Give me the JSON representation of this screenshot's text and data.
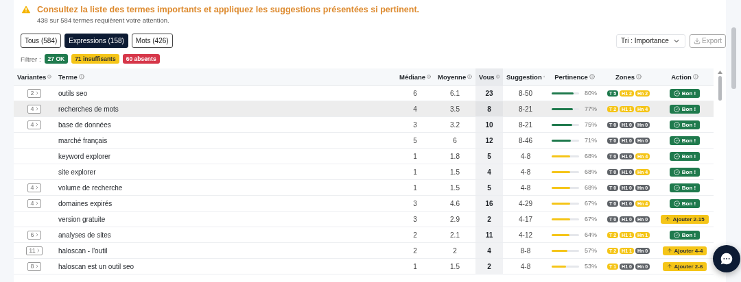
{
  "alert": {
    "title": "Consultez la liste des termes importants et appliquez les suggestions présentées si pertinent.",
    "subtitle": "438 sur 584 termes requièrent votre attention."
  },
  "tabs": [
    {
      "label": "Tous (584)",
      "selected": false
    },
    {
      "label": "Expressions (158)",
      "selected": true
    },
    {
      "label": "Mots (426)",
      "selected": false
    }
  ],
  "sort": {
    "value": "Tri : Importance"
  },
  "export": {
    "label": "Export",
    "disabled": true
  },
  "filter": {
    "label": "Filtrer :",
    "chips": [
      {
        "label": "27 OK",
        "color": "#1f7a4d"
      },
      {
        "label": "71 insuffisants",
        "color": "#f5c518"
      },
      {
        "label": "60 absents",
        "color": "#d63649"
      }
    ]
  },
  "table": {
    "columns": [
      "Variantes",
      "Terme",
      "Médiane",
      "Moyenne",
      "Vous",
      "Suggestion",
      "Pertinence",
      "Zones",
      "Action"
    ],
    "rows": [
      {
        "variants": "2",
        "term": "outils seo",
        "median": "6",
        "mean": "6.1",
        "you": "23",
        "suggestion": "8-50",
        "pertinence": {
          "level": 0.8,
          "reading": "80%",
          "color": "#1f7a4d"
        },
        "zones": [
          {
            "label": "T 5",
            "color": "#1f7a4d"
          },
          {
            "label": "H1 2",
            "color": "#f5c518"
          },
          {
            "label": "Hn 2",
            "color": "#f5c518"
          }
        ],
        "action": {
          "kind": "good",
          "label": "Bon !"
        },
        "highlighted": false
      },
      {
        "variants": "4",
        "term": "recherches de mots",
        "median": "4",
        "mean": "3.5",
        "you": "8",
        "suggestion": "8-21",
        "pertinence": {
          "level": 0.77,
          "reading": "77%",
          "color": "#1f7a4d"
        },
        "zones": [
          {
            "label": "T 2",
            "color": "#f5c518"
          },
          {
            "label": "H1 1",
            "color": "#f5c518"
          },
          {
            "label": "Hn 4",
            "color": "#f5c518"
          }
        ],
        "action": {
          "kind": "good",
          "label": "Bon !"
        },
        "highlighted": true
      },
      {
        "variants": "4",
        "term": "base de données",
        "median": "3",
        "mean": "3.2",
        "you": "10",
        "suggestion": "8-21",
        "pertinence": {
          "level": 0.75,
          "reading": "75%",
          "color": "#1f7a4d"
        },
        "zones": [
          {
            "label": "T 0",
            "color": "#5f6368"
          },
          {
            "label": "H1 0",
            "color": "#5f6368"
          },
          {
            "label": "Hn 0",
            "color": "#5f6368"
          }
        ],
        "action": {
          "kind": "good",
          "label": "Bon !"
        },
        "highlighted": false
      },
      {
        "term": "marché français",
        "median": "5",
        "mean": "6",
        "you": "12",
        "suggestion": "8-46",
        "pertinence": {
          "level": 0.71,
          "reading": "71%",
          "color": "#1f7a4d"
        },
        "zones": [
          {
            "label": "T 0",
            "color": "#5f6368"
          },
          {
            "label": "H1 0",
            "color": "#5f6368"
          },
          {
            "label": "Hn 0",
            "color": "#5f6368"
          }
        ],
        "action": {
          "kind": "good",
          "label": "Bon !"
        },
        "highlighted": false
      },
      {
        "term": "keyword explorer",
        "median": "1",
        "mean": "1.8",
        "you": "5",
        "suggestion": "4-8",
        "pertinence": {
          "level": 0.68,
          "reading": "68%",
          "color": "#f5c518"
        },
        "zones": [
          {
            "label": "T 0",
            "color": "#5f6368"
          },
          {
            "label": "H1 0",
            "color": "#5f6368"
          },
          {
            "label": "Hn 4",
            "color": "#f5c518"
          }
        ],
        "action": {
          "kind": "good",
          "label": "Bon !"
        },
        "highlighted": false
      },
      {
        "term": "site explorer",
        "median": "1",
        "mean": "1.5",
        "you": "4",
        "suggestion": "4-8",
        "pertinence": {
          "level": 0.68,
          "reading": "68%",
          "color": "#f5c518"
        },
        "zones": [
          {
            "label": "T 0",
            "color": "#5f6368"
          },
          {
            "label": "H1 0",
            "color": "#5f6368"
          },
          {
            "label": "Hn 4",
            "color": "#f5c518"
          }
        ],
        "action": {
          "kind": "good",
          "label": "Bon !"
        },
        "highlighted": false
      },
      {
        "variants": "4",
        "term": "volume de recherche",
        "median": "1",
        "mean": "1.5",
        "you": "5",
        "suggestion": "4-8",
        "pertinence": {
          "level": 0.68,
          "reading": "68%",
          "color": "#f5c518"
        },
        "zones": [
          {
            "label": "T 0",
            "color": "#5f6368"
          },
          {
            "label": "H1 0",
            "color": "#5f6368"
          },
          {
            "label": "Hn 0",
            "color": "#5f6368"
          }
        ],
        "action": {
          "kind": "good",
          "label": "Bon !"
        },
        "highlighted": false
      },
      {
        "variants": "4",
        "term": "domaines expirés",
        "median": "3",
        "mean": "4.6",
        "you": "16",
        "suggestion": "4-29",
        "pertinence": {
          "level": 0.67,
          "reading": "67%",
          "color": "#f5c518"
        },
        "zones": [
          {
            "label": "T 0",
            "color": "#5f6368"
          },
          {
            "label": "H1 0",
            "color": "#5f6368"
          },
          {
            "label": "Hn 4",
            "color": "#f5c518"
          }
        ],
        "action": {
          "kind": "good",
          "label": "Bon !"
        },
        "highlighted": false
      },
      {
        "term": "version gratuite",
        "median": "3",
        "mean": "2.9",
        "you": "2",
        "suggestion": "4-17",
        "pertinence": {
          "level": 0.67,
          "reading": "67%",
          "color": "#f5c518"
        },
        "zones": [
          {
            "label": "T 0",
            "color": "#5f6368"
          },
          {
            "label": "H1 0",
            "color": "#5f6368"
          },
          {
            "label": "Hn 0",
            "color": "#5f6368"
          }
        ],
        "action": {
          "kind": "add",
          "label": "Ajouter 2-15"
        },
        "highlighted": false
      },
      {
        "variants": "6",
        "term": "analyses de sites",
        "median": "2",
        "mean": "2.1",
        "you": "11",
        "suggestion": "4-12",
        "pertinence": {
          "level": 0.64,
          "reading": "64%",
          "color": "#f5c518"
        },
        "zones": [
          {
            "label": "T 2",
            "color": "#f5c518"
          },
          {
            "label": "H1 1",
            "color": "#f5c518"
          },
          {
            "label": "Hn 1",
            "color": "#f5c518"
          }
        ],
        "action": {
          "kind": "good",
          "label": "Bon !"
        },
        "highlighted": false
      },
      {
        "variants": "11",
        "term": "haloscan - l'outil",
        "median": "2",
        "mean": "2",
        "you": "4",
        "suggestion": "8-8",
        "pertinence": {
          "level": 0.57,
          "reading": "57%",
          "color": "#f5c518"
        },
        "zones": [
          {
            "label": "T 2",
            "color": "#f5c518"
          },
          {
            "label": "H1 1",
            "color": "#f5c518"
          },
          {
            "label": "Hn 0",
            "color": "#5f6368"
          }
        ],
        "action": {
          "kind": "add",
          "label": "Ajouter 4-4"
        },
        "highlighted": false
      },
      {
        "variants": "8",
        "term": "haloscan est un outil seo",
        "median": "1",
        "mean": "1.5",
        "you": "2",
        "suggestion": "4-8",
        "pertinence": {
          "level": 0.53,
          "reading": "53%",
          "color": "#f5c518"
        },
        "zones": [
          {
            "label": "T 1",
            "color": "#f5c518"
          },
          {
            "label": "H1 0",
            "color": "#5f6368"
          },
          {
            "label": "Hn 0",
            "color": "#5f6368"
          }
        ],
        "action": {
          "kind": "add",
          "label": "Ajouter 2-6"
        },
        "highlighted": false
      }
    ]
  }
}
